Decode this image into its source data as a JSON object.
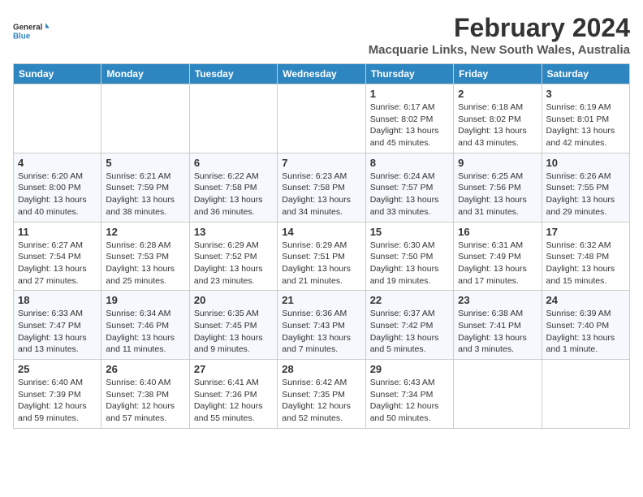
{
  "logo": {
    "line1": "General",
    "line2": "Blue"
  },
  "title": "February 2024",
  "location": "Macquarie Links, New South Wales, Australia",
  "days_header": [
    "Sunday",
    "Monday",
    "Tuesday",
    "Wednesday",
    "Thursday",
    "Friday",
    "Saturday"
  ],
  "weeks": [
    [
      {
        "day": "",
        "info": ""
      },
      {
        "day": "",
        "info": ""
      },
      {
        "day": "",
        "info": ""
      },
      {
        "day": "",
        "info": ""
      },
      {
        "day": "1",
        "info": "Sunrise: 6:17 AM\nSunset: 8:02 PM\nDaylight: 13 hours\nand 45 minutes."
      },
      {
        "day": "2",
        "info": "Sunrise: 6:18 AM\nSunset: 8:02 PM\nDaylight: 13 hours\nand 43 minutes."
      },
      {
        "day": "3",
        "info": "Sunrise: 6:19 AM\nSunset: 8:01 PM\nDaylight: 13 hours\nand 42 minutes."
      }
    ],
    [
      {
        "day": "4",
        "info": "Sunrise: 6:20 AM\nSunset: 8:00 PM\nDaylight: 13 hours\nand 40 minutes."
      },
      {
        "day": "5",
        "info": "Sunrise: 6:21 AM\nSunset: 7:59 PM\nDaylight: 13 hours\nand 38 minutes."
      },
      {
        "day": "6",
        "info": "Sunrise: 6:22 AM\nSunset: 7:58 PM\nDaylight: 13 hours\nand 36 minutes."
      },
      {
        "day": "7",
        "info": "Sunrise: 6:23 AM\nSunset: 7:58 PM\nDaylight: 13 hours\nand 34 minutes."
      },
      {
        "day": "8",
        "info": "Sunrise: 6:24 AM\nSunset: 7:57 PM\nDaylight: 13 hours\nand 33 minutes."
      },
      {
        "day": "9",
        "info": "Sunrise: 6:25 AM\nSunset: 7:56 PM\nDaylight: 13 hours\nand 31 minutes."
      },
      {
        "day": "10",
        "info": "Sunrise: 6:26 AM\nSunset: 7:55 PM\nDaylight: 13 hours\nand 29 minutes."
      }
    ],
    [
      {
        "day": "11",
        "info": "Sunrise: 6:27 AM\nSunset: 7:54 PM\nDaylight: 13 hours\nand 27 minutes."
      },
      {
        "day": "12",
        "info": "Sunrise: 6:28 AM\nSunset: 7:53 PM\nDaylight: 13 hours\nand 25 minutes."
      },
      {
        "day": "13",
        "info": "Sunrise: 6:29 AM\nSunset: 7:52 PM\nDaylight: 13 hours\nand 23 minutes."
      },
      {
        "day": "14",
        "info": "Sunrise: 6:29 AM\nSunset: 7:51 PM\nDaylight: 13 hours\nand 21 minutes."
      },
      {
        "day": "15",
        "info": "Sunrise: 6:30 AM\nSunset: 7:50 PM\nDaylight: 13 hours\nand 19 minutes."
      },
      {
        "day": "16",
        "info": "Sunrise: 6:31 AM\nSunset: 7:49 PM\nDaylight: 13 hours\nand 17 minutes."
      },
      {
        "day": "17",
        "info": "Sunrise: 6:32 AM\nSunset: 7:48 PM\nDaylight: 13 hours\nand 15 minutes."
      }
    ],
    [
      {
        "day": "18",
        "info": "Sunrise: 6:33 AM\nSunset: 7:47 PM\nDaylight: 13 hours\nand 13 minutes."
      },
      {
        "day": "19",
        "info": "Sunrise: 6:34 AM\nSunset: 7:46 PM\nDaylight: 13 hours\nand 11 minutes."
      },
      {
        "day": "20",
        "info": "Sunrise: 6:35 AM\nSunset: 7:45 PM\nDaylight: 13 hours\nand 9 minutes."
      },
      {
        "day": "21",
        "info": "Sunrise: 6:36 AM\nSunset: 7:43 PM\nDaylight: 13 hours\nand 7 minutes."
      },
      {
        "day": "22",
        "info": "Sunrise: 6:37 AM\nSunset: 7:42 PM\nDaylight: 13 hours\nand 5 minutes."
      },
      {
        "day": "23",
        "info": "Sunrise: 6:38 AM\nSunset: 7:41 PM\nDaylight: 13 hours\nand 3 minutes."
      },
      {
        "day": "24",
        "info": "Sunrise: 6:39 AM\nSunset: 7:40 PM\nDaylight: 13 hours\nand 1 minute."
      }
    ],
    [
      {
        "day": "25",
        "info": "Sunrise: 6:40 AM\nSunset: 7:39 PM\nDaylight: 12 hours\nand 59 minutes."
      },
      {
        "day": "26",
        "info": "Sunrise: 6:40 AM\nSunset: 7:38 PM\nDaylight: 12 hours\nand 57 minutes."
      },
      {
        "day": "27",
        "info": "Sunrise: 6:41 AM\nSunset: 7:36 PM\nDaylight: 12 hours\nand 55 minutes."
      },
      {
        "day": "28",
        "info": "Sunrise: 6:42 AM\nSunset: 7:35 PM\nDaylight: 12 hours\nand 52 minutes."
      },
      {
        "day": "29",
        "info": "Sunrise: 6:43 AM\nSunset: 7:34 PM\nDaylight: 12 hours\nand 50 minutes."
      },
      {
        "day": "",
        "info": ""
      },
      {
        "day": "",
        "info": ""
      }
    ]
  ]
}
